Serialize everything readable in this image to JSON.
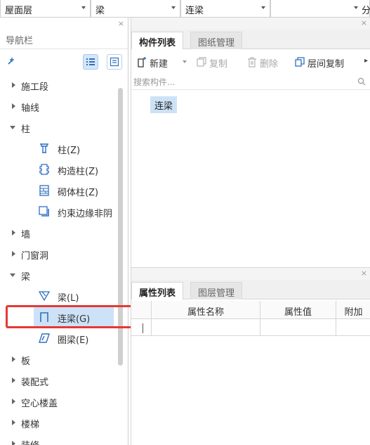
{
  "toolbar": {
    "floor": "屋面层",
    "category": "梁",
    "component": "连梁",
    "empty": "",
    "partial": "分"
  },
  "nav": {
    "title": "导航栏",
    "close": "×",
    "items": [
      {
        "label": "施工段",
        "level": 0,
        "expanded": false
      },
      {
        "label": "轴线",
        "level": 0,
        "expanded": false
      },
      {
        "label": "柱",
        "level": 0,
        "expanded": true
      },
      {
        "label": "柱(Z)",
        "level": 1,
        "icon": "column-icon"
      },
      {
        "label": "构造柱(Z)",
        "level": 1,
        "icon": "constructional-column-icon"
      },
      {
        "label": "砌体柱(Z)",
        "level": 1,
        "icon": "masonry-column-icon"
      },
      {
        "label": "约束边缘非阴",
        "level": 1,
        "icon": "constraint-edge-icon"
      },
      {
        "label": "墙",
        "level": 0,
        "expanded": false
      },
      {
        "label": "门窗洞",
        "level": 0,
        "expanded": false
      },
      {
        "label": "梁",
        "level": 0,
        "expanded": true
      },
      {
        "label": "梁(L)",
        "level": 1,
        "icon": "beam-icon"
      },
      {
        "label": "连梁(G)",
        "level": 1,
        "icon": "coupling-beam-icon",
        "selected": true
      },
      {
        "label": "圈梁(E)",
        "level": 1,
        "icon": "ring-beam-icon"
      },
      {
        "label": "板",
        "level": 0,
        "expanded": false
      },
      {
        "label": "装配式",
        "level": 0,
        "expanded": false
      },
      {
        "label": "空心楼盖",
        "level": 0,
        "expanded": false
      },
      {
        "label": "楼梯",
        "level": 0,
        "expanded": false
      },
      {
        "label": "装修",
        "level": 0,
        "expanded": false
      }
    ]
  },
  "components_panel": {
    "close": "×",
    "tabs": [
      "构件列表",
      "图纸管理"
    ],
    "actions": {
      "new": "新建",
      "copy": "复制",
      "delete": "删除",
      "floor_copy": "层间复制"
    },
    "search_placeholder": "搜索构件...",
    "items": [
      "连梁"
    ]
  },
  "properties_panel": {
    "close": "×",
    "tabs": [
      "属性列表",
      "图层管理"
    ],
    "columns": [
      "属性名称",
      "属性值",
      "附加"
    ],
    "rows": [
      {
        "index": "1",
        "name": "",
        "value": "",
        "extra": ""
      }
    ]
  },
  "colors": {
    "selection": "#cde2f7",
    "highlight_box": "#e53935",
    "icon_blue": "#2f6fbf"
  }
}
